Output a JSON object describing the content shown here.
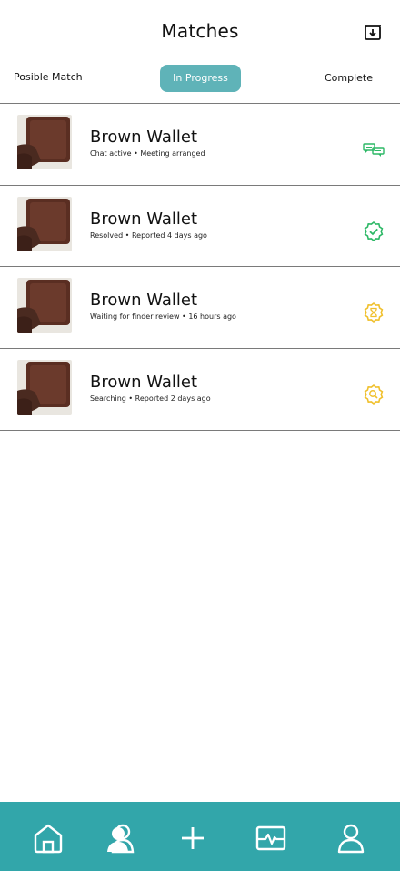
{
  "header": {
    "title": "Matches",
    "archive_icon": "archive-download-icon"
  },
  "tabs": [
    {
      "label": "Posible Match",
      "active": false
    },
    {
      "label": "In Progress",
      "active": true
    },
    {
      "label": "Complete",
      "active": false
    }
  ],
  "colors": {
    "accent": "#32a6aa",
    "active_tab": "#5fb3b8",
    "status_green": "#2db866",
    "status_yellow": "#f0c02c"
  },
  "matches": [
    {
      "title": "Brown Wallet",
      "subtitle": "Chat active • Meeting arranged",
      "status_icon": "chat-bubbles-icon"
    },
    {
      "title": "Brown Wallet",
      "subtitle": "Resolved • Reported 4 days ago",
      "status_icon": "verified-check-icon"
    },
    {
      "title": "Brown Wallet",
      "subtitle": "Waiting for finder review • 16 hours ago",
      "status_icon": "hourglass-badge-icon"
    },
    {
      "title": "Brown Wallet",
      "subtitle": "Searching • Reported 2 days ago",
      "status_icon": "search-badge-icon"
    }
  ],
  "bottom_nav": [
    "home-icon",
    "users-icon",
    "plus-icon",
    "activity-icon",
    "profile-icon"
  ]
}
